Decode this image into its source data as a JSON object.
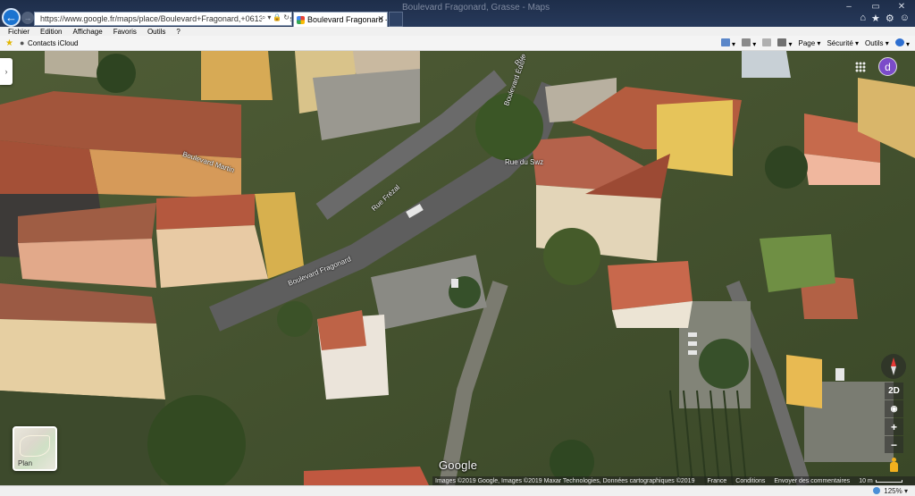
{
  "browser": {
    "url": "https://www.google.fr/maps/place/Boulevard+Fragonard,+06130+Grasse/@43.65651,6",
    "url_domain": "google.fr",
    "tab_title": "Boulevard Fragonard - Goo...",
    "ghost_title": "Boulevard Fragonard, Grasse - Maps"
  },
  "menu": {
    "items": [
      "Fichier",
      "Edition",
      "Affichage",
      "Favoris",
      "Outils",
      "?"
    ]
  },
  "favorites": {
    "link": "Contacts iCloud"
  },
  "command_bar": {
    "page": "Page",
    "security": "Sécurité",
    "tools": "Outils"
  },
  "map": {
    "street_labels": {
      "fragonard": "Boulevard Fragonard",
      "martin": "Boulevard Martin",
      "frezal": "Rue Frézal",
      "swz": "Rue du Swz",
      "edith": "Boulevard Édith",
      "rue": "Rue"
    },
    "avatar_letter": "d",
    "plan_label": "Plan",
    "google_logo": "Google",
    "view_toggle": "2D",
    "zoom_in": "+",
    "zoom_out": "−"
  },
  "attribution": {
    "images": "Images ©2019 Google, Images ©2019 Maxar Technologies, Données cartographiques ©2019",
    "country": "France",
    "terms": "Conditions",
    "feedback": "Envoyer des commentaires",
    "scale": "10 m"
  },
  "status": {
    "zoom": "125%"
  },
  "colors": {
    "back_button": "#1b73d0",
    "avatar": "#7b4bc9",
    "compass_red": "#e53935",
    "pegman": "#f2b01e"
  }
}
